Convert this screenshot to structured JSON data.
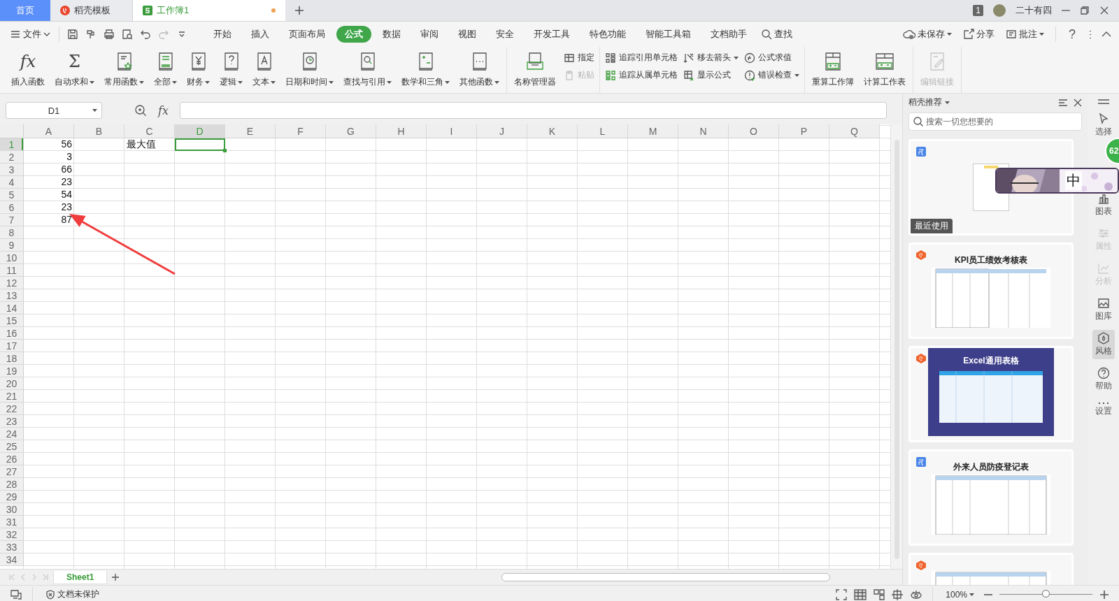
{
  "tabs": [
    {
      "label": "首页",
      "kind": "home",
      "selected": false,
      "modified": false
    },
    {
      "label": "稻壳模板",
      "kind": "daoke",
      "selected": false,
      "modified": false
    },
    {
      "label": "工作簿1",
      "kind": "sheet",
      "selected": true,
      "modified": true
    }
  ],
  "window": {
    "badge": "1",
    "user": "二十有四"
  },
  "menu": {
    "file": "文件",
    "quick_tools": [
      {
        "disabled": false
      },
      {
        "disabled": false
      },
      {
        "disabled": false
      },
      {
        "disabled": false
      },
      {
        "disabled": false
      },
      {
        "disabled": true
      },
      {
        "disabled": false
      }
    ],
    "items": [
      {
        "label": "开始",
        "selected": false
      },
      {
        "label": "插入",
        "selected": false
      },
      {
        "label": "页面布局",
        "selected": false
      },
      {
        "label": "公式",
        "selected": true
      },
      {
        "label": "数据",
        "selected": false
      },
      {
        "label": "审阅",
        "selected": false
      },
      {
        "label": "视图",
        "selected": false
      },
      {
        "label": "安全",
        "selected": false
      },
      {
        "label": "开发工具",
        "selected": false
      },
      {
        "label": "特色功能",
        "selected": false
      },
      {
        "label": "智能工具箱",
        "selected": false
      },
      {
        "label": "文档助手",
        "selected": false
      }
    ],
    "search": "查找",
    "actions": [
      {
        "label": "未保存",
        "dropdown": true
      },
      {
        "label": "分享",
        "dropdown": false
      },
      {
        "label": "批注",
        "dropdown": true
      }
    ],
    "help": "?"
  },
  "ribbon": [
    {
      "items": [
        {
          "kind": "large",
          "label": "插入函数",
          "glyph": "fx",
          "dropdown": false,
          "disabled": false
        },
        {
          "kind": "large",
          "label": "自动求和",
          "glyph": "Σ",
          "dropdown": true,
          "disabled": false
        },
        {
          "kind": "large",
          "label": "常用函数",
          "dropdown": true,
          "disabled": false
        },
        {
          "kind": "large",
          "label": "全部",
          "dropdown": true,
          "disabled": false
        },
        {
          "kind": "large",
          "label": "财务",
          "dropdown": true,
          "disabled": false
        },
        {
          "kind": "large",
          "label": "逻辑",
          "dropdown": true,
          "disabled": false
        },
        {
          "kind": "large",
          "label": "文本",
          "dropdown": true,
          "disabled": false
        },
        {
          "kind": "large",
          "label": "日期和时间",
          "dropdown": true,
          "disabled": false
        },
        {
          "kind": "large",
          "label": "查找与引用",
          "dropdown": true,
          "disabled": false
        },
        {
          "kind": "large",
          "label": "数学和三角",
          "dropdown": true,
          "disabled": false
        },
        {
          "kind": "large",
          "label": "其他函数",
          "dropdown": true,
          "disabled": false
        }
      ]
    },
    {
      "items": [
        {
          "kind": "large",
          "label": "名称管理器",
          "dropdown": false,
          "disabled": false
        },
        {
          "kind": "stack",
          "buttons": [
            {
              "label": "指定",
              "dropdown": false,
              "disabled": false
            },
            {
              "label": "粘贴",
              "dropdown": false,
              "disabled": true
            }
          ]
        }
      ]
    },
    {
      "items": [
        {
          "kind": "stack",
          "buttons": [
            {
              "label": "追踪引用单元格",
              "dropdown": false,
              "disabled": false
            },
            {
              "label": "追踪从属单元格",
              "dropdown": false,
              "disabled": false
            }
          ]
        },
        {
          "kind": "stack",
          "buttons": [
            {
              "label": "移去箭头",
              "dropdown": true,
              "disabled": false
            },
            {
              "label": "显示公式",
              "dropdown": false,
              "disabled": false
            }
          ]
        },
        {
          "kind": "stack",
          "buttons": [
            {
              "label": "公式求值",
              "dropdown": false,
              "disabled": false
            },
            {
              "label": "错误检查",
              "dropdown": true,
              "disabled": false
            }
          ]
        }
      ]
    },
    {
      "items": [
        {
          "kind": "large",
          "label": "重算工作簿",
          "dropdown": false,
          "disabled": false
        },
        {
          "kind": "large",
          "label": "计算工作表",
          "dropdown": false,
          "disabled": false
        }
      ]
    },
    {
      "items": [
        {
          "kind": "large",
          "label": "编辑链接",
          "dropdown": false,
          "disabled": true
        }
      ]
    }
  ],
  "sheet": {
    "name_box": "D1",
    "fx": "fx",
    "columns": [
      {
        "label": "A",
        "selected": false
      },
      {
        "label": "B",
        "selected": false
      },
      {
        "label": "C",
        "selected": false
      },
      {
        "label": "D",
        "selected": true
      },
      {
        "label": "E",
        "selected": false
      },
      {
        "label": "F",
        "selected": false
      },
      {
        "label": "G",
        "selected": false
      },
      {
        "label": "H",
        "selected": false
      },
      {
        "label": "I",
        "selected": false
      },
      {
        "label": "J",
        "selected": false
      },
      {
        "label": "K",
        "selected": false
      },
      {
        "label": "L",
        "selected": false
      },
      {
        "label": "M",
        "selected": false
      },
      {
        "label": "N",
        "selected": false
      },
      {
        "label": "O",
        "selected": false
      },
      {
        "label": "P",
        "selected": false
      },
      {
        "label": "Q",
        "selected": false
      }
    ],
    "rows": [
      {
        "label": "1",
        "selected": true,
        "cells": [
          {
            "text": "56",
            "kind": "number"
          },
          null,
          {
            "text": "最大值",
            "kind": "text"
          }
        ]
      },
      {
        "label": "2",
        "selected": false,
        "cells": [
          {
            "text": "3",
            "kind": "number"
          }
        ]
      },
      {
        "label": "3",
        "selected": false,
        "cells": [
          {
            "text": "66",
            "kind": "number"
          }
        ]
      },
      {
        "label": "4",
        "selected": false,
        "cells": [
          {
            "text": "23",
            "kind": "number"
          }
        ]
      },
      {
        "label": "5",
        "selected": false,
        "cells": [
          {
            "text": "54",
            "kind": "number"
          }
        ]
      },
      {
        "label": "6",
        "selected": false,
        "cells": [
          {
            "text": "23",
            "kind": "number"
          }
        ]
      },
      {
        "label": "7",
        "selected": false,
        "cells": [
          {
            "text": "87",
            "kind": "number"
          }
        ]
      },
      {
        "label": "8",
        "selected": false
      },
      {
        "label": "9",
        "selected": false
      },
      {
        "label": "10",
        "selected": false
      },
      {
        "label": "11",
        "selected": false
      },
      {
        "label": "12",
        "selected": false
      },
      {
        "label": "13",
        "selected": false
      },
      {
        "label": "14",
        "selected": false
      },
      {
        "label": "15",
        "selected": false
      },
      {
        "label": "16",
        "selected": false
      },
      {
        "label": "17",
        "selected": false
      },
      {
        "label": "18",
        "selected": false
      },
      {
        "label": "19",
        "selected": false
      },
      {
        "label": "20",
        "selected": false
      },
      {
        "label": "21",
        "selected": false
      },
      {
        "label": "22",
        "selected": false
      },
      {
        "label": "23",
        "selected": false
      },
      {
        "label": "24",
        "selected": false
      },
      {
        "label": "25",
        "selected": false
      },
      {
        "label": "26",
        "selected": false
      },
      {
        "label": "27",
        "selected": false
      },
      {
        "label": "28",
        "selected": false
      },
      {
        "label": "29",
        "selected": false
      },
      {
        "label": "30",
        "selected": false
      },
      {
        "label": "31",
        "selected": false
      },
      {
        "label": "32",
        "selected": false
      },
      {
        "label": "33",
        "selected": false
      },
      {
        "label": "34",
        "selected": false
      }
    ],
    "sheets": [
      {
        "label": "Sheet1",
        "selected": true
      }
    ],
    "annotation": {
      "kind": "arrow"
    }
  },
  "panel": {
    "title": "稻壳推荐",
    "search_placeholder": "搜索一切您想要的",
    "cards": [
      {
        "kind": "free",
        "dark": false,
        "tag": "最近使用"
      },
      {
        "kind": "daoke",
        "dark": false,
        "title": "KPI员工绩效考核表"
      },
      {
        "kind": "daoke",
        "dark": true,
        "title": "Excel通用表格"
      },
      {
        "kind": "free",
        "dark": false,
        "title": "外来人员防疫登记表"
      },
      {
        "kind": "daoke",
        "dark": false
      }
    ]
  },
  "sidebar": [
    {
      "label": "选择",
      "selected": false,
      "disabled": false
    },
    {
      "label": "图表",
      "selected": false,
      "disabled": false
    },
    {
      "label": "属性",
      "selected": false,
      "disabled": true
    },
    {
      "label": "分析",
      "selected": false,
      "disabled": true
    },
    {
      "label": "图库",
      "selected": false,
      "disabled": false
    },
    {
      "label": "风格",
      "selected": true,
      "disabled": false
    },
    {
      "label": "帮助",
      "selected": false,
      "disabled": false
    },
    {
      "label": "设置",
      "selected": false,
      "disabled": false
    }
  ],
  "status": {
    "protect": "文档未保护",
    "zoom": "100%",
    "level": 0.5
  },
  "overlay": {
    "ime": "中",
    "score": "62"
  }
}
